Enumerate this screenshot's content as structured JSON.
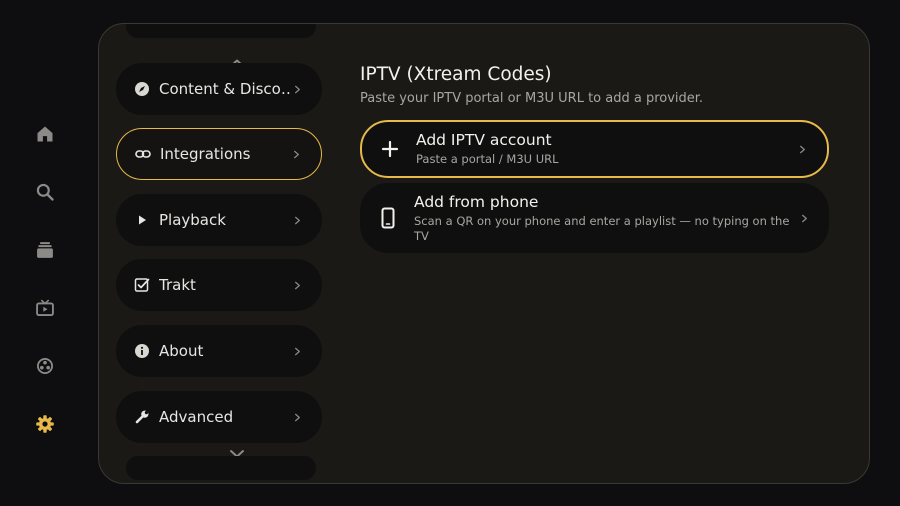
{
  "nav_rail": {
    "items": [
      {
        "icon": "home-icon",
        "active": false
      },
      {
        "icon": "search-icon",
        "active": false
      },
      {
        "icon": "library-icon",
        "active": false
      },
      {
        "icon": "live-tv-icon",
        "active": false
      },
      {
        "icon": "addons-icon",
        "active": false
      },
      {
        "icon": "gear-icon",
        "active": true
      }
    ],
    "colors": {
      "inactive": "#8b8a86",
      "active": "#e7b84a"
    }
  },
  "settings_menu": {
    "items": [
      {
        "label": "Content & Disco…",
        "icon": "compass-icon",
        "active": false
      },
      {
        "label": "Integrations",
        "icon": "link-icon",
        "active": true
      },
      {
        "label": "Playback",
        "icon": "play-icon",
        "active": false
      },
      {
        "label": "Trakt",
        "icon": "checkbox-icon",
        "active": false
      },
      {
        "label": "About",
        "icon": "info-icon",
        "active": false
      },
      {
        "label": "Advanced",
        "icon": "wrench-icon",
        "active": false
      }
    ]
  },
  "content": {
    "title": "IPTV (Xtream Codes)",
    "subtitle": "Paste your IPTV portal or M3U URL to add a provider.",
    "cards": [
      {
        "title": "Add IPTV account",
        "subtitle": "Paste a portal / M3U URL",
        "icon": "plus-icon",
        "active": true
      },
      {
        "title": "Add from phone",
        "subtitle": "Scan a QR on your phone and enter a playlist — no typing on the TV",
        "icon": "phone-icon",
        "active": false
      }
    ]
  },
  "colors": {
    "accent": "#e7b84a",
    "panel_bg": "#1b1915",
    "item_bg": "#0f0f10",
    "page_bg": "#0e0e11"
  }
}
